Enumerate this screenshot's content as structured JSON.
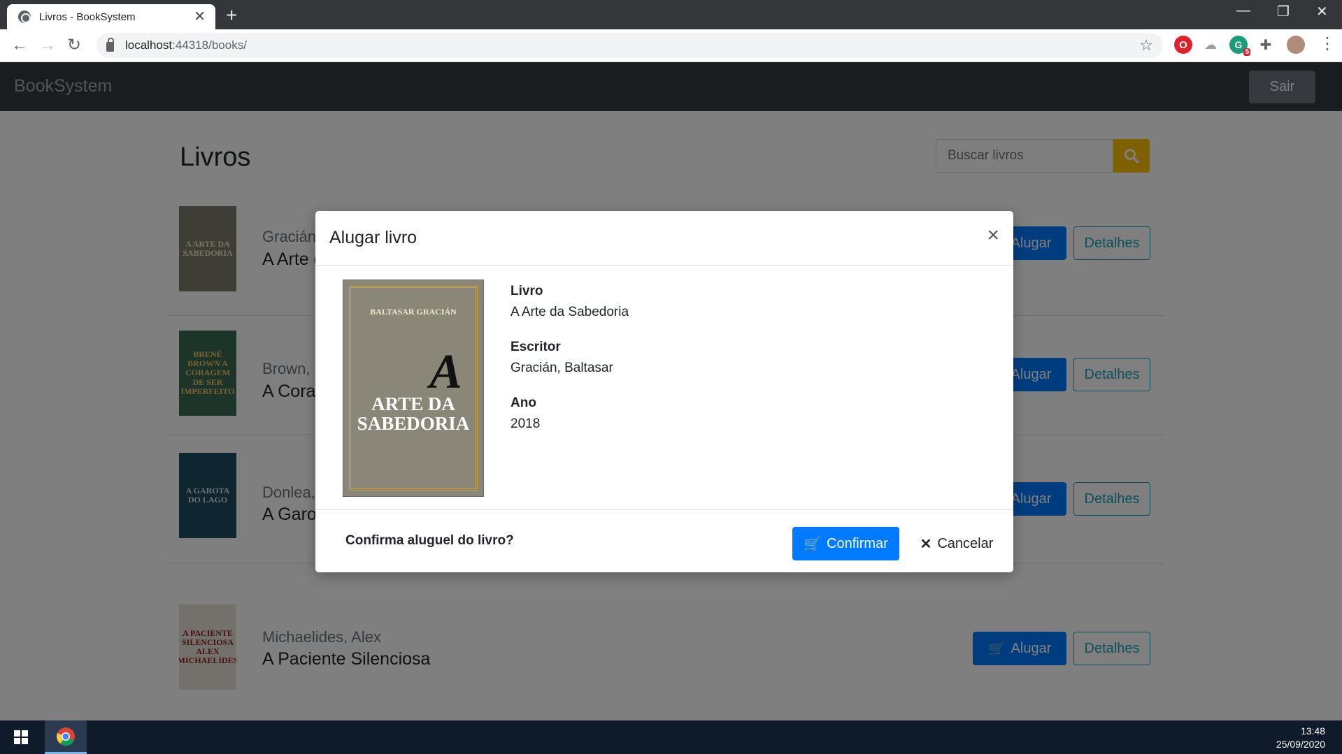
{
  "browser": {
    "tab_title": "Livros - BookSystem",
    "url_host": "localhost",
    "url_port": ":44318",
    "url_path": "/books/",
    "extension_badge": "5"
  },
  "navbar": {
    "brand": "BookSystem",
    "logout_label": "Sair"
  },
  "page": {
    "title": "Livros",
    "search_placeholder": "Buscar livros"
  },
  "books": [
    {
      "author": "Gracián, Baltasar",
      "title": "A Arte da Sabedoria",
      "cover_text": "A ARTE DA SABEDORIA",
      "cover_color": "#7d7a6c"
    },
    {
      "author": "Brown, Brené",
      "title": "A Coragem de Ser Imperfeito",
      "cover_text": "BRENÉ BROWN A CORAGEM DE SER IMPERFEITO",
      "cover_color": "#3b6b52"
    },
    {
      "author": "Donlea, Charlie",
      "title": "A Garota do Lago",
      "cover_text": "A GAROTA DO LAGO",
      "cover_color": "#1f4a60"
    },
    {
      "author": "Michaelides, Alex",
      "title": "A Paciente Silenciosa",
      "cover_text": "A PACIENTE SILENCIOSA ALEX MICHAELIDES",
      "cover_color": "#e9e2d8"
    }
  ],
  "book_actions": {
    "rent_label": "Alugar",
    "details_label": "Detalhes"
  },
  "modal": {
    "title": "Alugar livro",
    "close_symbol": "×",
    "cover": {
      "author": "BALTASAR GRACIÁN",
      "letter": "A",
      "title_line1": "ARTE DA",
      "title_line2": "SABEDORIA"
    },
    "fields": [
      {
        "label": "Livro",
        "value": "A Arte da Sabedoria"
      },
      {
        "label": "Escritor",
        "value": "Gracián, Baltasar"
      },
      {
        "label": "Ano",
        "value": "2018"
      }
    ],
    "question": "Confirma aluguel do livro?",
    "confirm_label": "Confirmar",
    "cancel_label": "Cancelar"
  },
  "taskbar": {
    "time": "13:48",
    "date": "25/09/2020"
  },
  "colors": {
    "primary": "#007bff",
    "info": "#17a2b8",
    "warning": "#ffc107",
    "navbar": "#343a40",
    "secondary": "#6c757d"
  }
}
